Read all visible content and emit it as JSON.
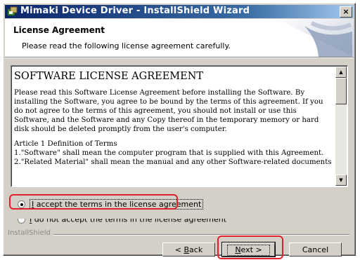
{
  "window": {
    "title": "Mimaki Device Driver - InstallShield Wizard",
    "close_label": "×"
  },
  "header": {
    "title": "License Agreement",
    "subtitle": "Please read the following license agreement carefully."
  },
  "license": {
    "heading": "SOFTWARE LICENSE AGREEMENT",
    "paragraphs": [
      "Please read this Software License Agreement before installing the Software. By installing the Software, you agree to be bound by the terms of this agreement. If you do not agree to the terms of this agreement, you should not install or use this Software, and the Software and any Copy thereof in the temporary memory or hard disk should be deleted promptly from the user's computer.",
      "Article 1 Definition of Terms"
    ],
    "lines": [
      "1.\"Software\" shall mean the computer program that is supplied with this Agreement.",
      "2.\"Related Material\" shall mean the manual and any other Software-related documents"
    ]
  },
  "options": {
    "accept_label_prefix": "",
    "accept_label_underline": "I",
    "accept_label_rest": " accept the terms in the license agreement",
    "accept_selected": true,
    "decline_label_underline": "I",
    "decline_label_rest": " do not accept the terms in the license agreement",
    "decline_selected": false
  },
  "footer": {
    "brand": "InstallShield",
    "back_prefix": "< ",
    "back_underline": "B",
    "back_rest": "ack",
    "next_underline": "N",
    "next_rest": "ext >",
    "cancel_label": "Cancel"
  },
  "colors": {
    "highlight": "#e0202a",
    "titlebar_start": "#0a246a",
    "dialog_bg": "#d4d0c8"
  }
}
